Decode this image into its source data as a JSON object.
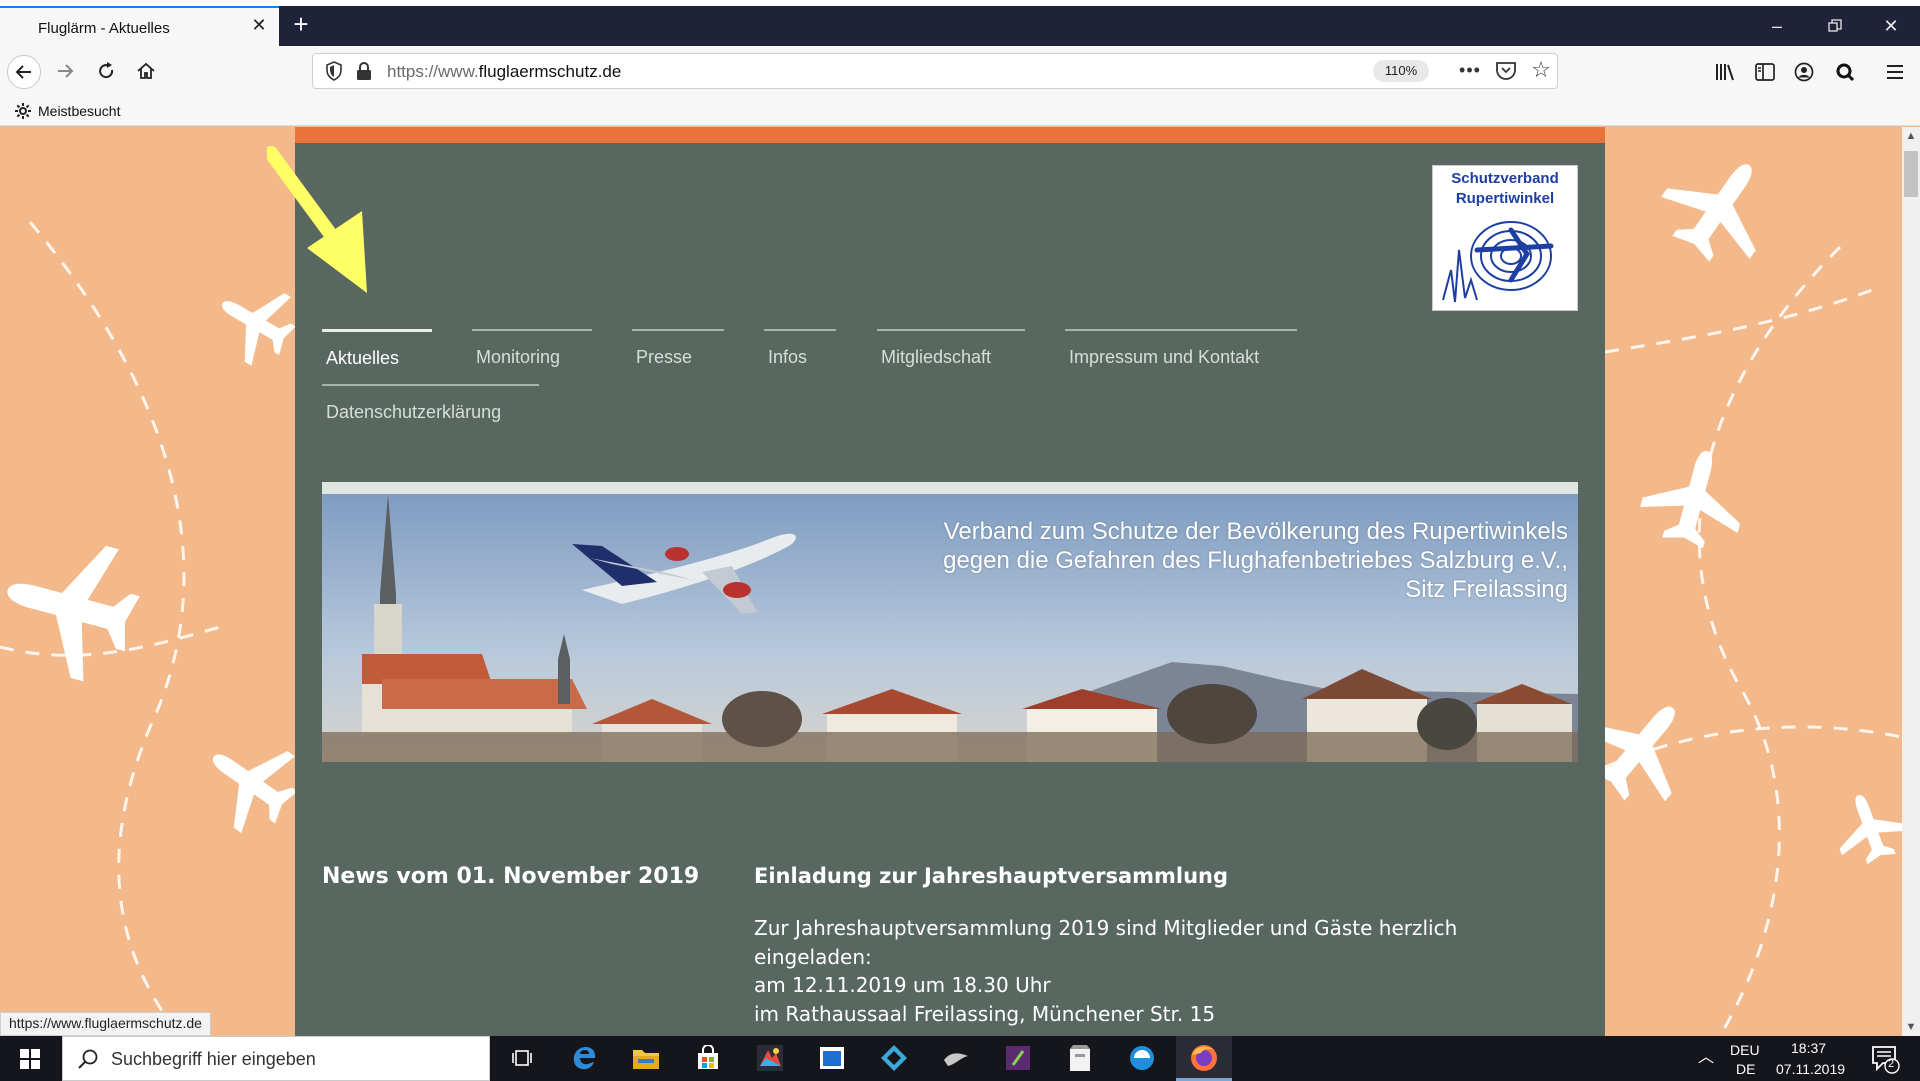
{
  "browser": {
    "tab_title": "Fluglärm - Aktuelles",
    "tab_close": "✕",
    "new_tab": "+",
    "url_prefix": "https://www.",
    "url_domain": "fluglaermschutz.de",
    "zoom": "110%",
    "page_actions": "•••",
    "bookmark": "Meistbesucht",
    "status_url": "https://www.fluglaermschutz.de"
  },
  "site": {
    "logo": {
      "line1": "Schutzverband",
      "line2": "Rupertiwinkel"
    },
    "nav": [
      {
        "label": "Aktuelles",
        "active": true
      },
      {
        "label": "Monitoring"
      },
      {
        "label": "Presse"
      },
      {
        "label": "Infos"
      },
      {
        "label": "Mitgliedschaft"
      },
      {
        "label": "Impressum und Kontakt"
      },
      {
        "label": "Datenschutzerklärung"
      }
    ],
    "hero": {
      "line1": "Verband zum Schutze der Bevölkerung des Rupertiwinkels",
      "line2": "gegen die Gefahren des Flughafenbetriebes Salzburg e.V.,",
      "line3": "Sitz Freilassing"
    },
    "news": {
      "date": "News vom 01. November 2019",
      "title": "Einladung zur Jahreshauptversammlung",
      "lines": [
        "Zur Jahreshauptversammlung 2019 sind Mitglieder und Gäste herzlich",
        "eingeladen:",
        "am 12.11.2019 um 18.30 Uhr",
        "im Rathaussaal Freilassing, Münchener Str. 15"
      ]
    }
  },
  "taskbar": {
    "search_placeholder": "Suchbegriff hier eingeben",
    "lang_1": "DEU",
    "lang_2": "DE",
    "time": "18:37",
    "date": "07.11.2019",
    "notification_count": "2"
  },
  "colors": {
    "page_background": "#f4b98a",
    "site_background": "#586760",
    "accent_orange": "#e8743a",
    "annotation_arrow": "#ffff66",
    "logo_blue": "#1d3fa3"
  },
  "icons": [
    "back-icon",
    "forward-icon",
    "reload-icon",
    "home-icon",
    "shield-icon",
    "lock-icon",
    "pocket-icon",
    "star-icon",
    "library-icon",
    "sidebar-icon",
    "account-icon",
    "extension-icon",
    "menu-icon",
    "gear-icon",
    "windows-start-icon",
    "search-icon"
  ]
}
